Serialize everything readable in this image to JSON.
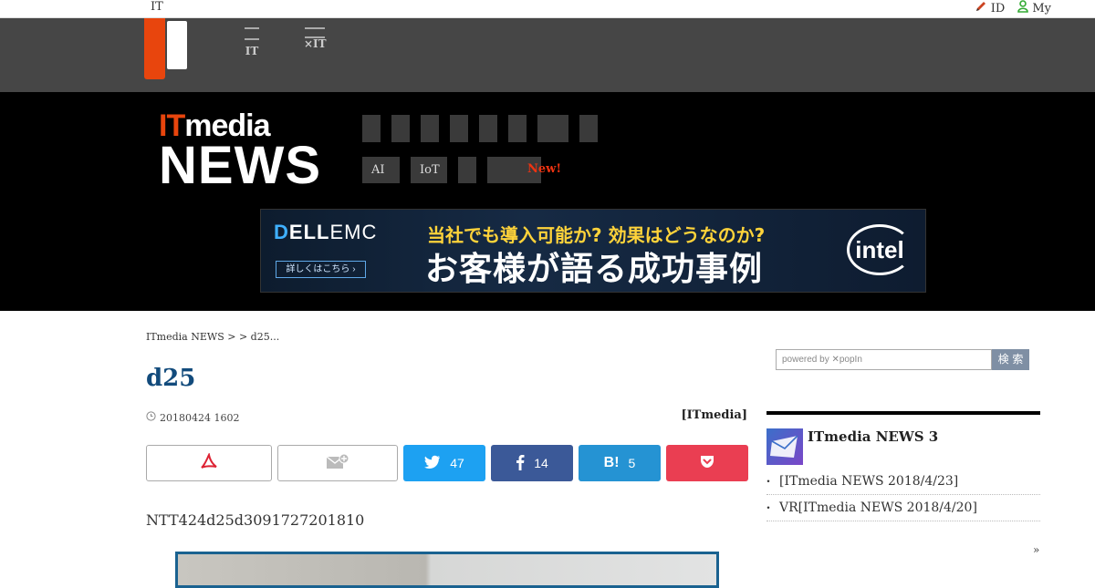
{
  "topbar": {
    "left": "IT",
    "id_label": "ID",
    "my_label": "My"
  },
  "global_nav": [
    {
      "l1": "",
      "l2": "IT"
    },
    {
      "l1": "",
      "l2": "×IT"
    }
  ],
  "brand": {
    "it": "IT",
    "media": "media",
    "news": "NEWS"
  },
  "category_tags": [
    "AI",
    "IoT"
  ],
  "new_tag": "New!",
  "ad": {
    "brand_dell_d": "D",
    "brand_dell_rest": "ELL",
    "brand_emc": "EMC",
    "button": "詳しくはこちら ›",
    "line1": "当社でも導入可能か? 効果はどうなのか?",
    "line2": "お客様が語る成功事例",
    "intel": "intel"
  },
  "breadcrumb": "ITmedia NEWS >  > d25...",
  "article": {
    "title": "d25",
    "date": "20180424 1602",
    "source": "[ITmedia]",
    "lead": "NTT424d25d3091727201810"
  },
  "share": {
    "twitter_count": "47",
    "facebook_count": "14",
    "hatena_label": "B!",
    "hatena_count": "5"
  },
  "sidebar": {
    "search_placeholder": "powered by ✕popIn",
    "search_button": "検 索",
    "newsletter_title": "ITmedia NEWS 3",
    "items": [
      "[ITmedia NEWS  2018/4/23]",
      "VR[ITmedia NEWS  2018/4/20]"
    ],
    "more": "»"
  }
}
